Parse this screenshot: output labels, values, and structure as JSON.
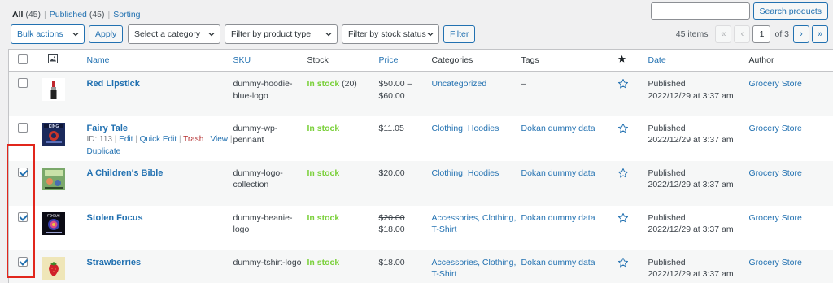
{
  "views": {
    "all_label": "All",
    "all_count": "(45)",
    "sep": "|",
    "published_label": "Published",
    "published_count": "(45)",
    "sorting_label": "Sorting"
  },
  "search": {
    "value": "",
    "button_label": "Search products"
  },
  "tablenav": {
    "bulk_actions": "Bulk actions",
    "apply_label": "Apply",
    "category_select": "Select a category",
    "product_type_select": "Filter by product type",
    "stock_status_select": "Filter by stock status",
    "filter_label": "Filter",
    "items_count": "45 items",
    "first_page": "«",
    "prev_page": "‹",
    "current_page": "1",
    "of_label": "of 3",
    "next_page": "›",
    "last_page": "»"
  },
  "columns": {
    "name": "Name",
    "sku": "SKU",
    "stock": "Stock",
    "price": "Price",
    "categories": "Categories",
    "tags": "Tags",
    "date": "Date",
    "author": "Author"
  },
  "rows": [
    {
      "name": "Red Lipstick",
      "sku": "dummy-hoodie-blue-logo",
      "stock": "In stock",
      "stock_count": "(20)",
      "price": "$50.00 – $60.00",
      "categories": "Uncategorized",
      "tags": "–",
      "status": "Published",
      "date": "2022/12/29 at 3:37 am",
      "author": "Grocery Store",
      "checked": false
    },
    {
      "name": "Fairy Tale",
      "sku": "dummy-wp-pennant",
      "stock": "In stock",
      "price": "$11.05",
      "categories": "Clothing, Hoodies",
      "tags": "Dokan dummy data",
      "status": "Published",
      "date": "2022/12/29 at 3:37 am",
      "author": "Grocery Store",
      "checked": false,
      "row_actions": {
        "id": "ID: 113",
        "edit": "Edit",
        "quick_edit": "Quick Edit",
        "trash": "Trash",
        "view": "View",
        "duplicate": "Duplicate",
        "pipe": "|"
      }
    },
    {
      "name": "A Children's Bible",
      "sku": "dummy-logo-collection",
      "stock": "In stock",
      "price": "$20.00",
      "categories": "Clothing, Hoodies",
      "tags": "Dokan dummy data",
      "status": "Published",
      "date": "2022/12/29 at 3:37 am",
      "author": "Grocery Store",
      "checked": true
    },
    {
      "name": "Stolen Focus",
      "sku": "dummy-beanie-logo",
      "stock": "In stock",
      "price_regular": "$20.00",
      "price_sale": "$18.00",
      "categories": "Accessories, Clothing, T-Shirt",
      "tags": "Dokan dummy data",
      "status": "Published",
      "date": "2022/12/29 at 3:37 am",
      "author": "Grocery Store",
      "checked": true
    },
    {
      "name": "Strawberries",
      "sku": "dummy-tshirt-logo",
      "stock": "In stock",
      "price": "$18.00",
      "categories": "Accessories, Clothing, T-Shirt",
      "tags": "Dokan dummy data",
      "status": "Published",
      "date": "2022/12/29 at 3:37 am",
      "author": "Grocery Store",
      "checked": true
    }
  ],
  "colors": {
    "link": "#2271b1",
    "in_stock": "#7ad03a",
    "trash": "#b32d2e",
    "highlight": "#e1261c"
  },
  "icons": {
    "image_column": "image-icon",
    "featured_column": "star-filled-icon",
    "row_featured": "star-outline-icon",
    "select_chevron": "chevron-down-icon"
  }
}
